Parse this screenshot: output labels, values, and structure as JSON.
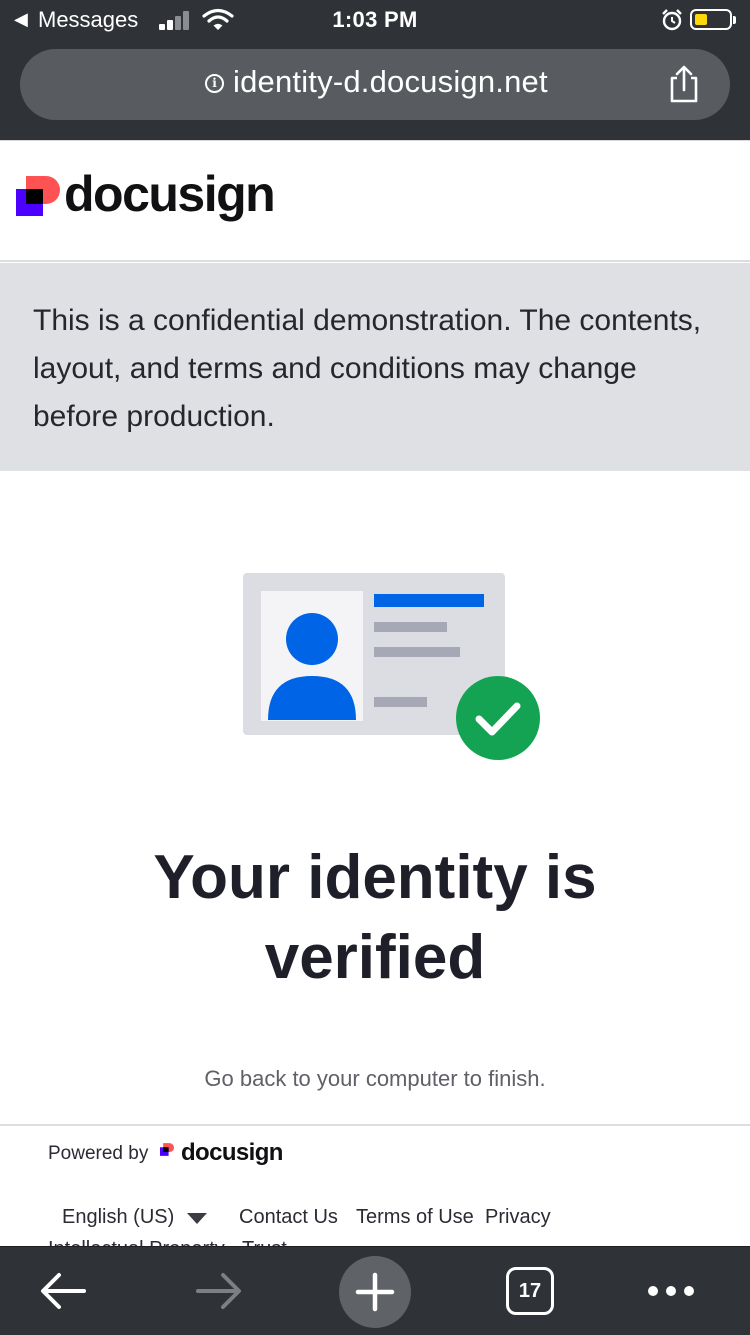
{
  "status_bar": {
    "back_app": "Messages",
    "time": "1:03 PM"
  },
  "browser": {
    "url": "identity-d.docusign.net",
    "tab_count": "17"
  },
  "header": {
    "brand": "docusign"
  },
  "banner": {
    "text": "This is a confidential demonstration. The contents, layout, and terms and conditions may change before production."
  },
  "main": {
    "heading_line1": "Your identity is",
    "heading_line2": "verified",
    "subtext": "Go back to your computer to finish."
  },
  "footer": {
    "powered_by": "Powered by",
    "brand": "docusign",
    "language": "English (US)",
    "links": [
      "Contact Us",
      "Terms of Use",
      "Privacy"
    ],
    "links_row2": [
      "Intellectual Property",
      "Trust"
    ]
  },
  "colors": {
    "brand_blue": "#0064e6",
    "success_green": "#13a352",
    "logo_red": "#ff5252",
    "logo_purple": "#4c00ff",
    "chrome": "#2f3236"
  },
  "icons": [
    "back-arrow-icon",
    "signal-icon",
    "wifi-icon",
    "alarm-icon",
    "battery-icon",
    "info-icon",
    "share-icon",
    "checkmark-icon",
    "back-icon",
    "forward-icon",
    "new-tab-icon",
    "tabs-icon",
    "more-icon"
  ]
}
